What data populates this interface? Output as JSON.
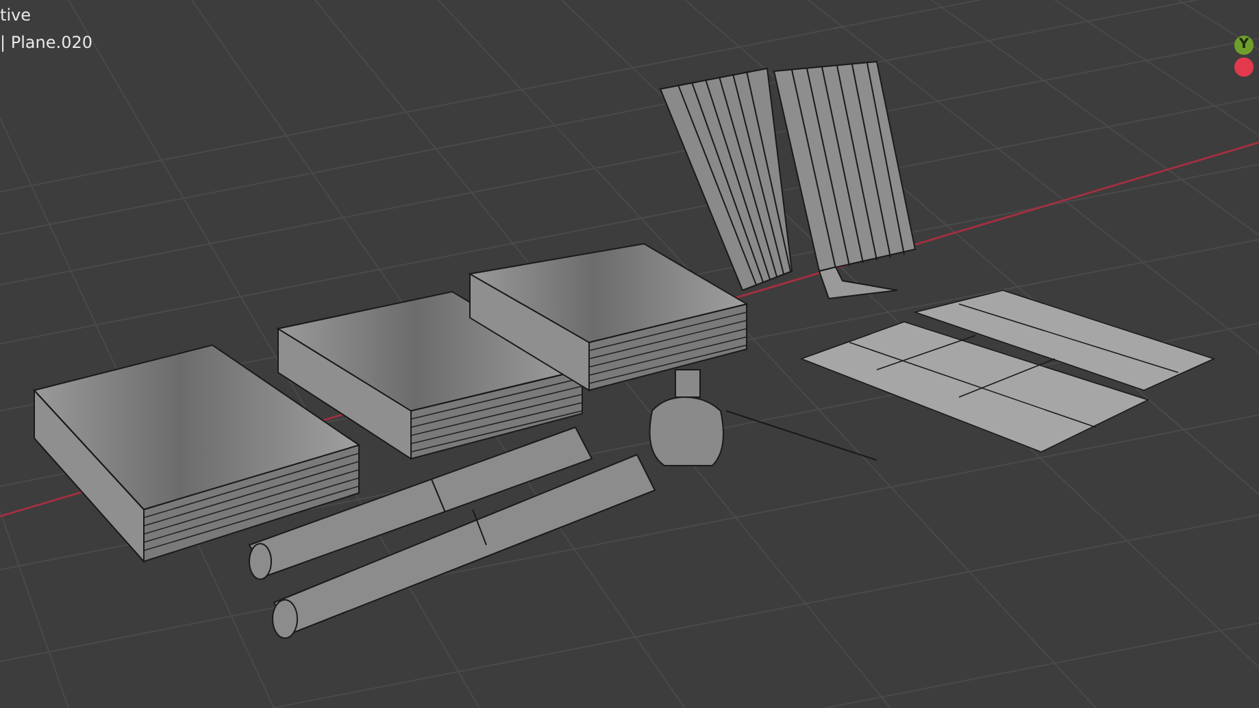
{
  "viewport": {
    "overlay_lines": [
      "tive",
      "| Plane.020"
    ]
  },
  "gizmo": {
    "axes": [
      {
        "kind": "labeled",
        "label": "Y",
        "color": "#6e9f2c"
      },
      {
        "kind": "dot",
        "color": "#e2394c"
      }
    ]
  }
}
